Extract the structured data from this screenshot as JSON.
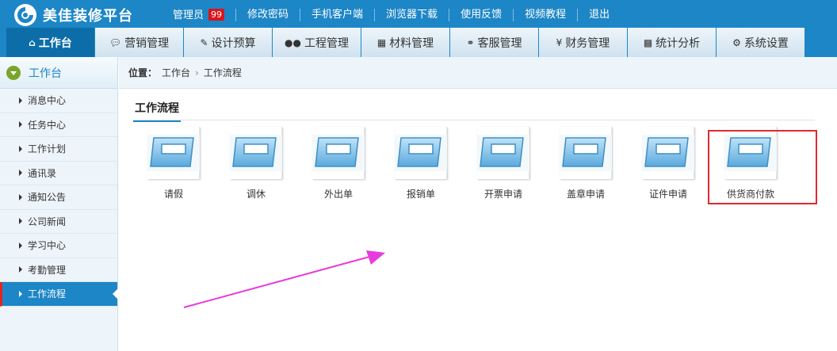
{
  "header": {
    "brand": "美佳装修平台",
    "links": [
      {
        "label": "管理员",
        "badge": "99"
      },
      {
        "label": "修改密码"
      },
      {
        "label": "手机客户端"
      },
      {
        "label": "浏览器下载"
      },
      {
        "label": "使用反馈"
      },
      {
        "label": "视频教程"
      },
      {
        "label": "退出"
      }
    ]
  },
  "nav": {
    "tabs": [
      {
        "label": "工作台",
        "icon": "home-icon"
      },
      {
        "label": "营销管理",
        "icon": "chat-icon"
      },
      {
        "label": "设计预算",
        "icon": "edit-icon"
      },
      {
        "label": "工程管理",
        "icon": "users-icon"
      },
      {
        "label": "材料管理",
        "icon": "grid-icon"
      },
      {
        "label": "客服管理",
        "icon": "headset-icon"
      },
      {
        "label": "财务管理",
        "icon": "yen-icon"
      },
      {
        "label": "统计分析",
        "icon": "chart-icon"
      },
      {
        "label": "系统设置",
        "icon": "gear-icon"
      }
    ]
  },
  "sidebar": {
    "title": "工作台",
    "items": [
      {
        "label": "消息中心"
      },
      {
        "label": "任务中心"
      },
      {
        "label": "工作计划"
      },
      {
        "label": "通讯录"
      },
      {
        "label": "通知公告"
      },
      {
        "label": "公司新闻"
      },
      {
        "label": "学习中心"
      },
      {
        "label": "考勤管理"
      },
      {
        "label": "工作流程"
      }
    ]
  },
  "breadcrumb": {
    "label": "位置：",
    "items": [
      "工作台",
      "工作流程"
    ],
    "separator": "›"
  },
  "section": {
    "title": "工作流程"
  },
  "tiles": [
    {
      "label": "请假"
    },
    {
      "label": "调休"
    },
    {
      "label": "外出单"
    },
    {
      "label": "报销单"
    },
    {
      "label": "开票申请"
    },
    {
      "label": "盖章申请"
    },
    {
      "label": "证件申请"
    },
    {
      "label": "供货商付款"
    }
  ],
  "colors": {
    "primary": "#1d86c6",
    "highlight": "#e3292f",
    "arrow": "#e83bdd",
    "badge": "#d9141b"
  }
}
